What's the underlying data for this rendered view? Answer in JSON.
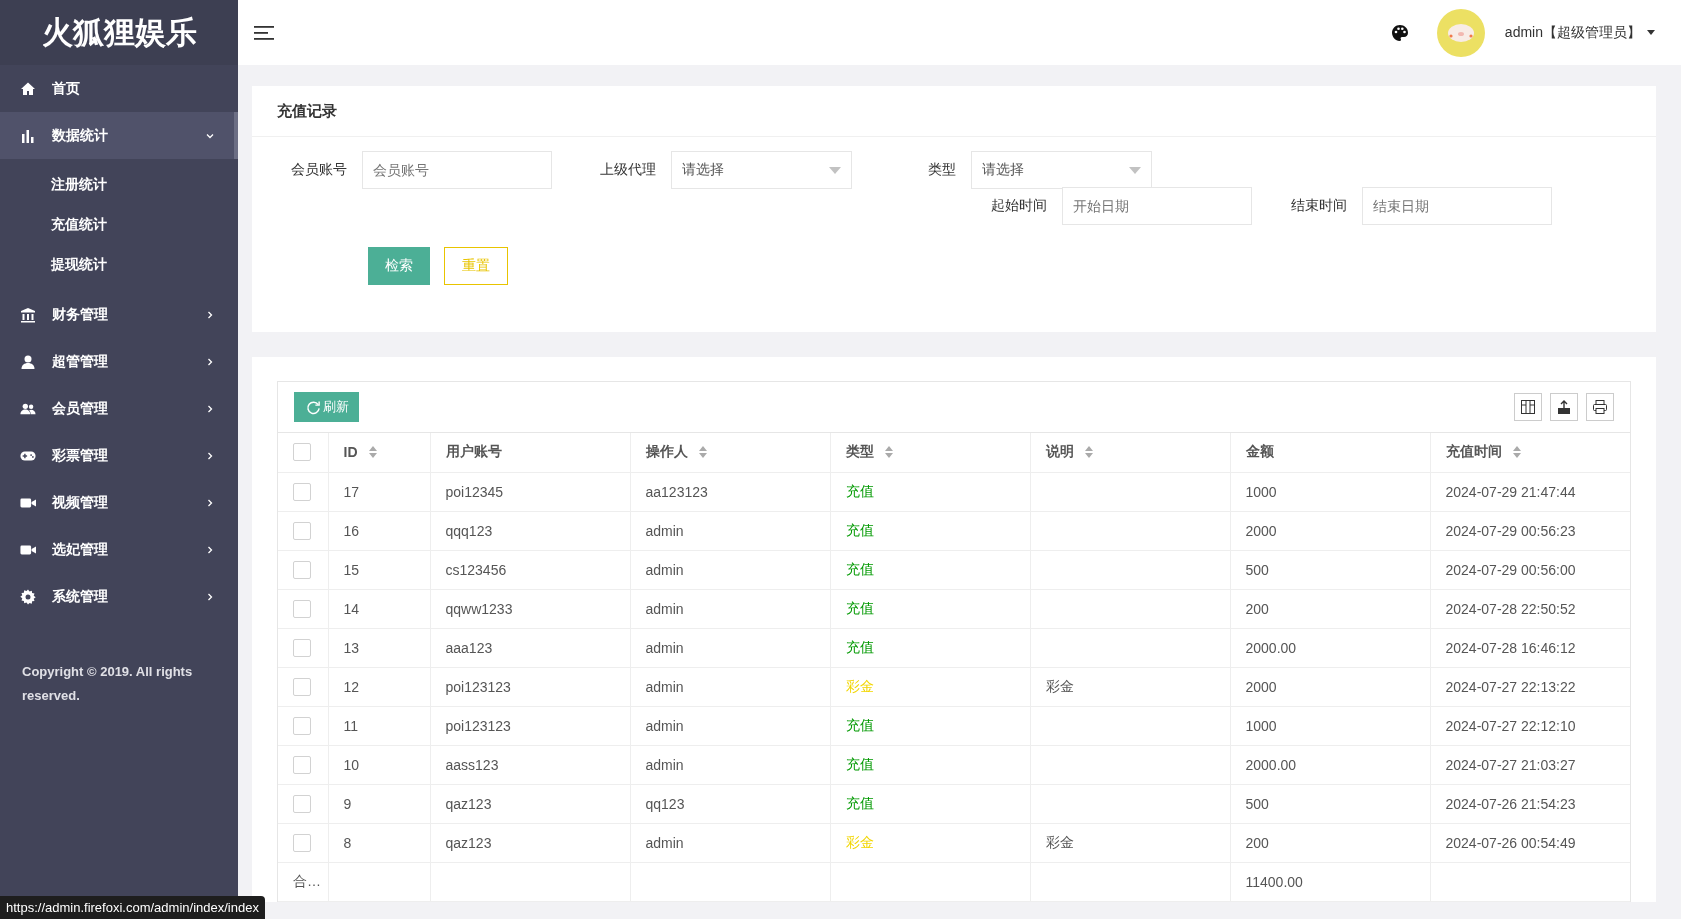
{
  "sidebar": {
    "logo": "火狐狸娱乐",
    "items": [
      {
        "kind": "link",
        "label": "首页",
        "selected": false
      },
      {
        "kind": "group",
        "label": "数据统计",
        "selected": true,
        "expanded": true,
        "children": [
          {
            "label": "注册统计"
          },
          {
            "label": "充值统计"
          },
          {
            "label": "提现统计"
          }
        ]
      },
      {
        "kind": "group",
        "label": "财务管理",
        "selected": false,
        "expanded": false
      },
      {
        "kind": "group",
        "label": "超管管理",
        "selected": false,
        "expanded": false
      },
      {
        "kind": "group",
        "label": "会员管理",
        "selected": false,
        "expanded": false
      },
      {
        "kind": "group",
        "label": "彩票管理",
        "selected": false,
        "expanded": false
      },
      {
        "kind": "group",
        "label": "视频管理",
        "selected": false,
        "expanded": false
      },
      {
        "kind": "group",
        "label": "选妃管理",
        "selected": false,
        "expanded": false
      },
      {
        "kind": "group",
        "label": "系统管理",
        "selected": false,
        "expanded": false
      }
    ],
    "copyright": "Copyright © 2019. All rights reserved."
  },
  "header": {
    "user": "admin【超级管理员】"
  },
  "filter": {
    "title": "充值记录",
    "fields": [
      {
        "kind": "input",
        "label": "会员账号",
        "placeholder": "会员账号"
      },
      {
        "kind": "select",
        "label": "上级代理",
        "placeholder": "请选择"
      },
      {
        "kind": "select",
        "label": "类型",
        "placeholder": "请选择"
      },
      {
        "kind": "input",
        "label": "起始时间",
        "placeholder": "开始日期"
      },
      {
        "kind": "input",
        "label": "结束时间",
        "placeholder": "结束日期"
      }
    ],
    "buttons": [
      {
        "kind": "primary",
        "label": "检索"
      },
      {
        "kind": "outline",
        "label": "重置"
      }
    ]
  },
  "table": {
    "refresh": "刷新",
    "header_checked": false,
    "columns": [
      {
        "label": "ID",
        "sortable": true
      },
      {
        "label": "用户账号",
        "sortable": false
      },
      {
        "label": "操作人",
        "sortable": true
      },
      {
        "label": "类型",
        "sortable": true
      },
      {
        "label": "说明",
        "sortable": true
      },
      {
        "label": "金额",
        "sortable": false
      },
      {
        "label": "充值时间",
        "sortable": true
      }
    ],
    "rows": [
      {
        "checked": false,
        "id": "17",
        "user": "poi12345",
        "operator": "aa123123",
        "type": "充值",
        "color": "#009900",
        "note": "",
        "amount": "1000",
        "time": "2024-07-29 21:47:44"
      },
      {
        "checked": false,
        "id": "16",
        "user": "qqq123",
        "operator": "admin",
        "type": "充值",
        "color": "#009900",
        "note": "",
        "amount": "2000",
        "time": "2024-07-29 00:56:23"
      },
      {
        "checked": false,
        "id": "15",
        "user": "cs123456",
        "operator": "admin",
        "type": "充值",
        "color": "#009900",
        "note": "",
        "amount": "500",
        "time": "2024-07-29 00:56:00"
      },
      {
        "checked": false,
        "id": "14",
        "user": "qqww1233",
        "operator": "admin",
        "type": "充值",
        "color": "#009900",
        "note": "",
        "amount": "200",
        "time": "2024-07-28 22:50:52"
      },
      {
        "checked": false,
        "id": "13",
        "user": "aaa123",
        "operator": "admin",
        "type": "充值",
        "color": "#009900",
        "note": "",
        "amount": "2000.00",
        "time": "2024-07-28 16:46:12"
      },
      {
        "checked": false,
        "id": "12",
        "user": "poi123123",
        "operator": "admin",
        "type": "彩金",
        "color": "#f2d600",
        "note": "彩金",
        "amount": "2000",
        "time": "2024-07-27 22:13:22"
      },
      {
        "checked": false,
        "id": "11",
        "user": "poi123123",
        "operator": "admin",
        "type": "充值",
        "color": "#009900",
        "note": "",
        "amount": "1000",
        "time": "2024-07-27 22:12:10"
      },
      {
        "checked": false,
        "id": "10",
        "user": "aass123",
        "operator": "admin",
        "type": "充值",
        "color": "#009900",
        "note": "",
        "amount": "2000.00",
        "time": "2024-07-27 21:03:27"
      },
      {
        "checked": false,
        "id": "9",
        "user": "qaz123",
        "operator": "qq123",
        "type": "充值",
        "color": "#009900",
        "note": "",
        "amount": "500",
        "time": "2024-07-26 21:54:23"
      },
      {
        "checked": false,
        "id": "8",
        "user": "qaz123",
        "operator": "admin",
        "type": "彩金",
        "color": "#f2d600",
        "note": "彩金",
        "amount": "200",
        "time": "2024-07-26 00:54:49"
      }
    ],
    "total_label": "合…",
    "total_amount": "11400.00"
  },
  "status_url": "https://admin.firefoxi.com/admin/index/index"
}
